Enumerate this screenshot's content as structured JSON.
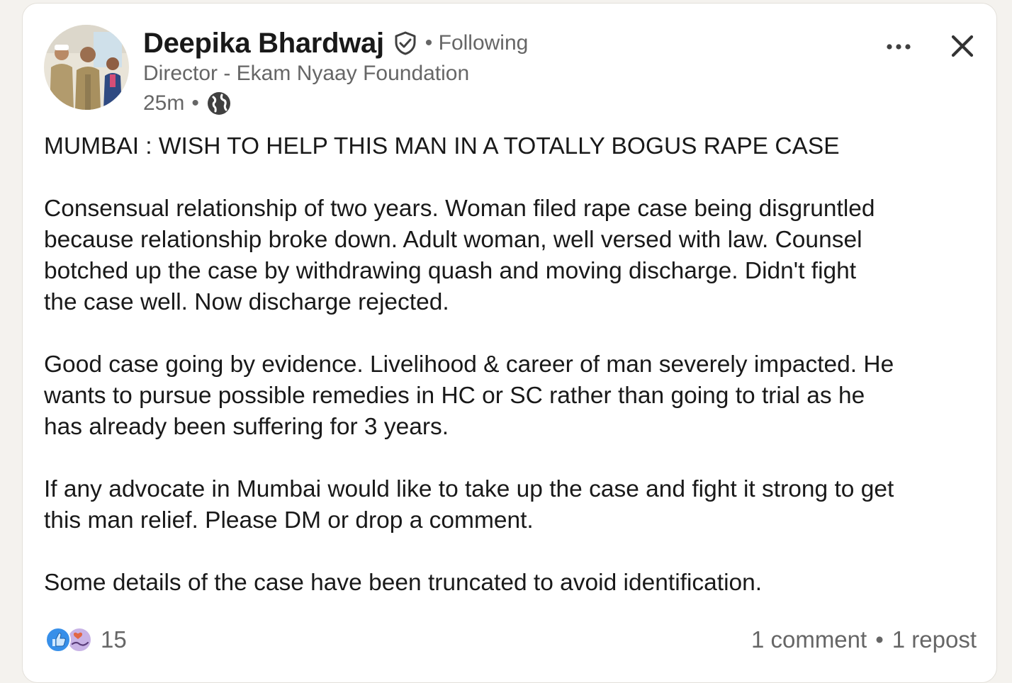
{
  "author": {
    "name": "Deepika Bhardwaj",
    "follow_status": "• Following",
    "headline": "Director - Ekam Nyaay Foundation",
    "time": "25m",
    "meta_separator": "•",
    "visibility_icon": "globe-icon",
    "verified_icon": "verified-shield-icon"
  },
  "post": {
    "paragraphs": [
      [
        "MUMBAI : WISH TO HELP THIS MAN IN A TOTALLY BOGUS RAPE CASE"
      ],
      [
        "Consensual relationship of two years. Woman filed rape case being disgruntled",
        "because relationship broke down. Adult woman, well versed with law. Counsel",
        "botched up the case by withdrawing quash and moving discharge. Didn't fight",
        "the case well. Now discharge rejected."
      ],
      [
        "Good case going by evidence. Livelihood & career of man severely impacted. He",
        "wants to pursue possible remedies in HC or SC rather than going to trial as he",
        "has already been suffering for 3 years."
      ],
      [
        "If any advocate in Mumbai would like to take up the case and fight it strong to get",
        "this man relief. Please DM or drop a comment."
      ],
      [
        "Some details of the case have been truncated to avoid identification."
      ]
    ]
  },
  "social": {
    "reaction_icons": [
      "like-icon",
      "support-icon"
    ],
    "reaction_count": "15",
    "comments": "1 comment",
    "separator": "•",
    "reposts": "1 repost"
  },
  "controls": {
    "more_icon": "more-options-icon",
    "close_icon": "close-icon"
  },
  "colors": {
    "text_primary": "#191919",
    "text_secondary": "#666666",
    "like_blue": "#378fe9",
    "support_purple": "#c8b3e6",
    "page_bg": "#f4f2ee"
  }
}
